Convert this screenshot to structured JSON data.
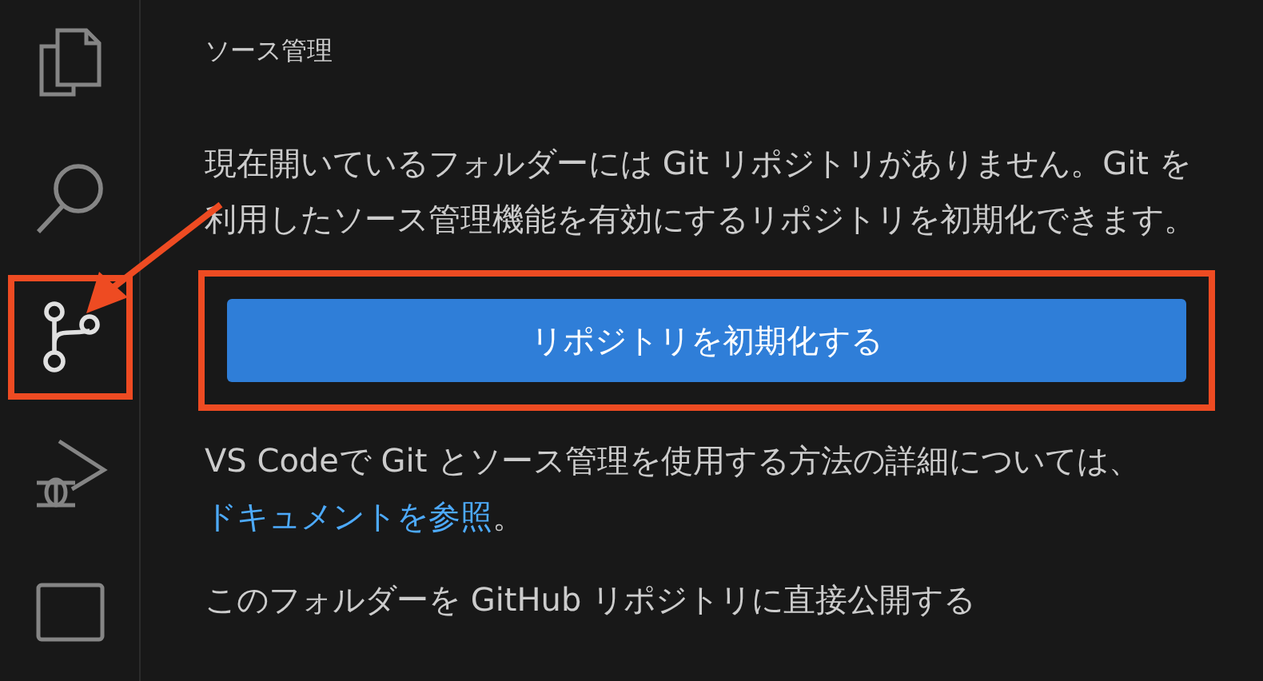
{
  "activity_bar": {
    "items": [
      {
        "kind": "files",
        "selected": false
      },
      {
        "kind": "search",
        "selected": false
      },
      {
        "kind": "source-control",
        "selected": true
      },
      {
        "kind": "debug",
        "selected": false
      },
      {
        "kind": "panel",
        "selected": false
      }
    ]
  },
  "panel": {
    "title": "ソース管理",
    "message": "現在開いているフォルダーには Git リポジトリがありません。Git を利用したソース管理機能を有効にするリポジトリを初期化できます。",
    "button": "リポジトリを初期化する",
    "docs": {
      "prefix": "VS Codeで Git とソース管理を使用する方法の詳細については、",
      "link": "ドキュメントを参照",
      "suffix": "。"
    },
    "publish": "このフォルダーを GitHub リポジトリに直接公開する"
  }
}
